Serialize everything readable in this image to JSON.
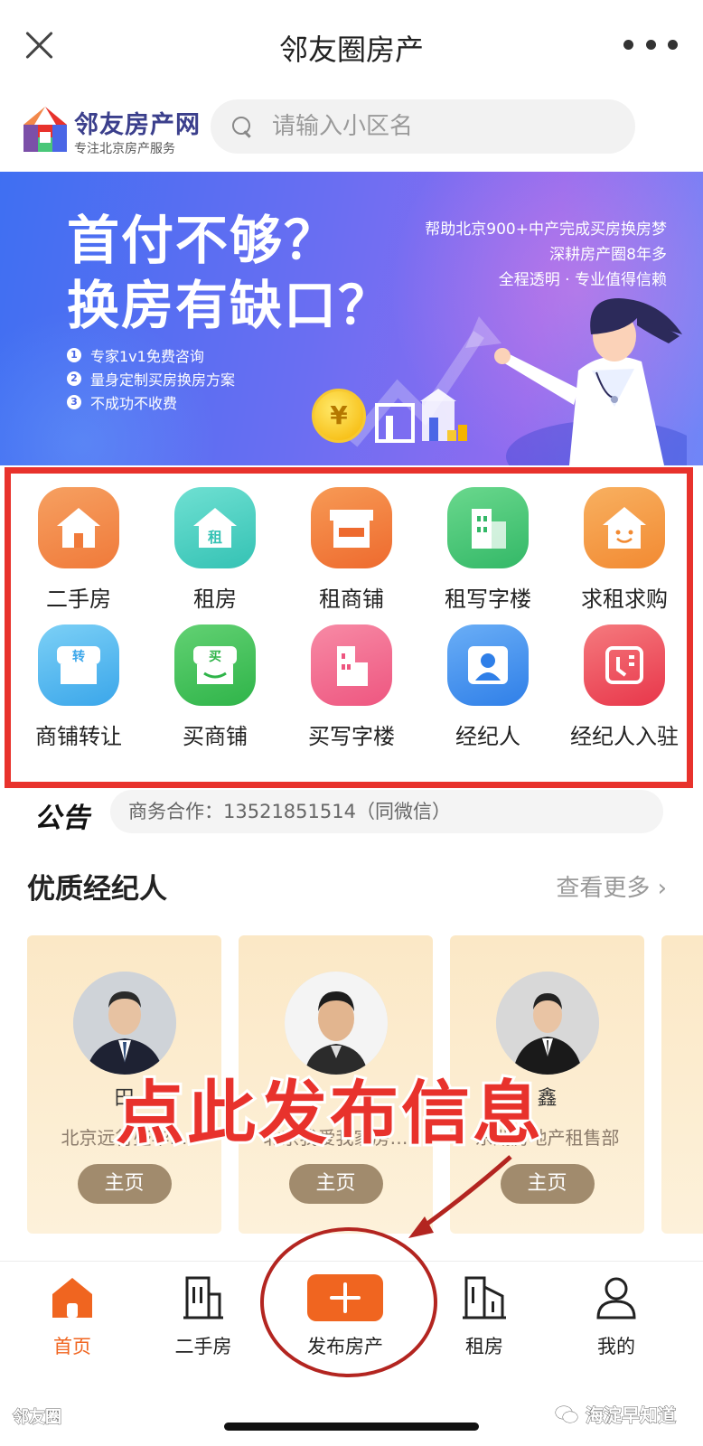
{
  "topbar": {
    "title": "邻友圈房产"
  },
  "header": {
    "logo_name": "邻友房产网",
    "logo_sub": "专注北京房产服务",
    "search_placeholder": "请输入小区名"
  },
  "banner": {
    "headline_1": "首付不够？",
    "headline_2": "换房有缺口？",
    "points": [
      "专家1v1免费咨询",
      "量身定制买房换房方案",
      "不成功不收费"
    ],
    "right_lines": [
      "帮助北京900+中产完成买房换房梦",
      "深耕房产圈8年多",
      "全程透明 · 专业值得信赖"
    ],
    "coin_symbol": "¥"
  },
  "grid": {
    "row1": [
      {
        "label": "二手房",
        "icon": "house-icon",
        "color": "#f2884a"
      },
      {
        "label": "租房",
        "icon": "rent-house-icon",
        "color": "#4fd1c5"
      },
      {
        "label": "租商铺",
        "icon": "shop-icon",
        "color": "#f47c3c"
      },
      {
        "label": "租写字楼",
        "icon": "office-building-icon",
        "color": "#49c779"
      },
      {
        "label": "求租求购",
        "icon": "smile-house-icon",
        "color": "#f59a45"
      }
    ],
    "row2": [
      {
        "label": "商铺转让",
        "icon": "transfer-shop-icon",
        "color": "#54b8f0",
        "glyph": "转"
      },
      {
        "label": "买商铺",
        "icon": "buy-shop-icon",
        "color": "#45c35c",
        "glyph": "买"
      },
      {
        "label": "买写字楼",
        "icon": "buy-office-icon",
        "color": "#f2668b"
      },
      {
        "label": "经纪人",
        "icon": "agent-icon",
        "color": "#3d8ef0"
      },
      {
        "label": "经纪人入驻",
        "icon": "agent-join-icon",
        "color": "#ef4f5a"
      }
    ],
    "row1_glyph_rent": "租"
  },
  "notice": {
    "tag": "公告",
    "text": "商务合作：13521851514（同微信）"
  },
  "agents": {
    "title": "优质经纪人",
    "see_more": "查看更多 ›",
    "cards": [
      {
        "name": "田",
        "company": "北京远行盛华…",
        "button": "主页"
      },
      {
        "name": "",
        "company": "北京我爱我家房…",
        "button": "主页"
      },
      {
        "name": "鑫",
        "company": "东湖房地产租售部",
        "button": "主页"
      }
    ]
  },
  "annotation": {
    "text": "点此发布信息"
  },
  "bottom_nav": {
    "items": [
      {
        "label": "首页",
        "icon": "home-icon",
        "active": true
      },
      {
        "label": "二手房",
        "icon": "building-icon"
      },
      {
        "label": "发布房产",
        "icon": "plus-icon"
      },
      {
        "label": "租房",
        "icon": "rent-building-icon"
      },
      {
        "label": "我的",
        "icon": "user-icon"
      }
    ]
  },
  "footer": {
    "left": "邻友圈",
    "right": "海淀早知道"
  },
  "colors": {
    "accent_orange": "#f06520",
    "annotation_red": "#e8322c",
    "agent_button": "#a18b6d"
  }
}
